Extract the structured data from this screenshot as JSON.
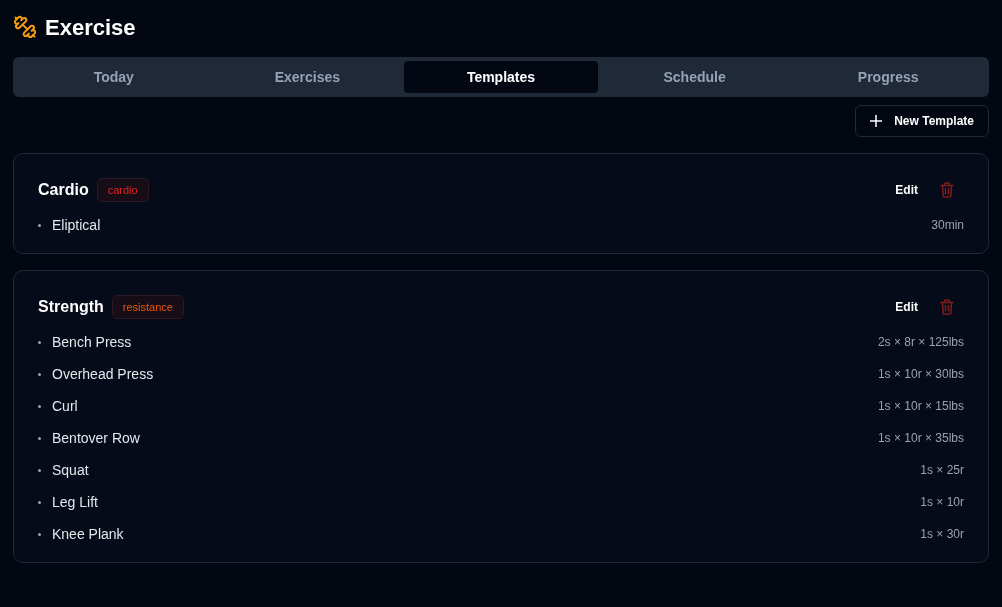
{
  "header": {
    "title": "Exercise"
  },
  "tabs": [
    {
      "label": "Today",
      "selected": false
    },
    {
      "label": "Exercises",
      "selected": false
    },
    {
      "label": "Templates",
      "selected": true
    },
    {
      "label": "Schedule",
      "selected": false
    },
    {
      "label": "Progress",
      "selected": false
    }
  ],
  "new_button": {
    "label": "New Template"
  },
  "templates": [
    {
      "name": "Cardio",
      "tag": {
        "label": "cardio",
        "color": "#dc2626"
      },
      "edit": "Edit",
      "items": [
        {
          "name": "Eliptical",
          "detail": "30min"
        }
      ]
    },
    {
      "name": "Strength",
      "tag": {
        "label": "resistance",
        "color": "#ea580c"
      },
      "edit": "Edit",
      "items": [
        {
          "name": "Bench Press",
          "detail": "2s × 8r × 125lbs"
        },
        {
          "name": "Overhead Press",
          "detail": "1s × 10r × 30lbs"
        },
        {
          "name": "Curl",
          "detail": "1s × 10r × 15lbs"
        },
        {
          "name": "Bentover Row",
          "detail": "1s × 10r × 35lbs"
        },
        {
          "name": "Squat",
          "detail": "1s × 25r"
        },
        {
          "name": "Leg Lift",
          "detail": "1s × 10r"
        },
        {
          "name": "Knee Plank",
          "detail": "1s × 30r"
        }
      ]
    }
  ]
}
